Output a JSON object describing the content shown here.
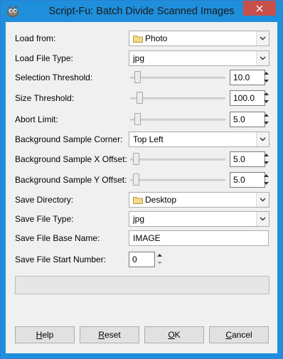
{
  "window": {
    "title": "Script-Fu: Batch Divide Scanned Images"
  },
  "fields": {
    "load_from": {
      "label": "Load from:",
      "value": "Photo"
    },
    "load_file_type": {
      "label": "Load File Type:",
      "value": "jpg"
    },
    "selection_threshold": {
      "label": "Selection Threshold:",
      "value": "10.0",
      "level": 0.05
    },
    "size_threshold": {
      "label": "Size Threshold:",
      "value": "100.0",
      "level": 0.07
    },
    "abort_limit": {
      "label": "Abort Limit:",
      "value": "5.0",
      "level": 0.05
    },
    "bg_sample_corner": {
      "label": "Background Sample Corner:",
      "value": "Top Left"
    },
    "bg_sample_x_offset": {
      "label": "Background Sample X Offset:",
      "value": "5.0",
      "level": 0.03
    },
    "bg_sample_y_offset": {
      "label": "Background Sample Y Offset:",
      "value": "5.0",
      "level": 0.03
    },
    "save_directory": {
      "label": "Save Directory:",
      "value": "Desktop"
    },
    "save_file_type": {
      "label": "Save File Type:",
      "value": "jpg"
    },
    "save_file_base_name": {
      "label": "Save File Base Name:",
      "value": "IMAGE"
    },
    "save_file_start_number": {
      "label": "Save File Start Number:",
      "value": "0"
    }
  },
  "buttons": {
    "help": {
      "first": "H",
      "rest": "elp"
    },
    "reset": {
      "first": "R",
      "rest": "eset"
    },
    "ok": {
      "first": "O",
      "rest": "K"
    },
    "cancel": {
      "first": "C",
      "rest": "ancel"
    }
  },
  "colors": {
    "title_bar": "#1f8fdc",
    "close_button": "#c7504b",
    "dialog_bg": "#f0f0f0"
  },
  "icons": {
    "app": "gimp-wilber-icon",
    "close": "close-icon",
    "folder": "folder-icon",
    "dropdown": "chevron-down-icon",
    "spin_up": "spin-up-icon",
    "spin_down": "spin-down-icon"
  }
}
